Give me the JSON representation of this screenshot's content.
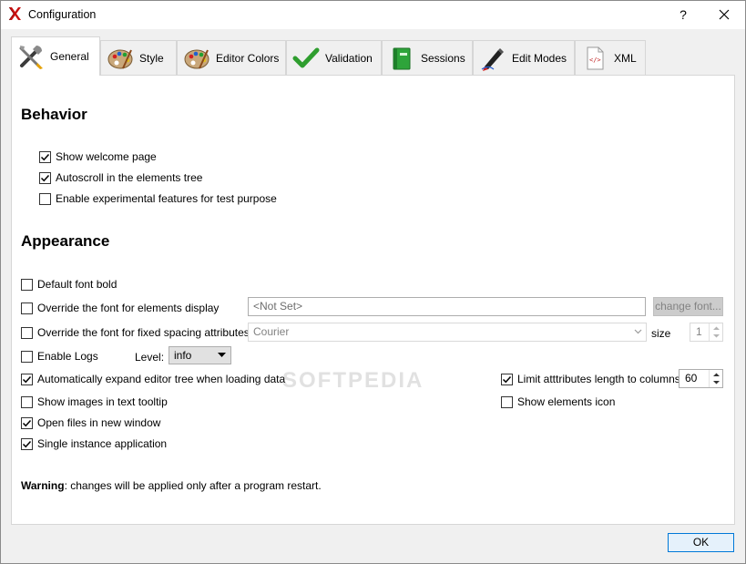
{
  "window": {
    "title": "Configuration",
    "help_label": "?",
    "close_icon": "close-icon"
  },
  "tabs": [
    {
      "label": "General",
      "icon": "tools-icon",
      "active": true
    },
    {
      "label": "Style",
      "icon": "palette-icon",
      "active": false
    },
    {
      "label": "Editor Colors",
      "icon": "palette-icon",
      "active": false
    },
    {
      "label": "Validation",
      "icon": "checkmark-icon",
      "active": false
    },
    {
      "label": "Sessions",
      "icon": "green-book-icon",
      "active": false
    },
    {
      "label": "Edit Modes",
      "icon": "pen-icon",
      "active": false
    },
    {
      "label": "XML",
      "icon": "xml-file-icon",
      "active": false
    }
  ],
  "behavior": {
    "title": "Behavior",
    "options": [
      {
        "label": "Show welcome page",
        "checked": true
      },
      {
        "label": "Autoscroll in the elements tree",
        "checked": true
      },
      {
        "label": "Enable experimental features for test purpose",
        "checked": false
      }
    ]
  },
  "appearance": {
    "title": "Appearance",
    "default_font_bold": {
      "label": "Default font bold",
      "checked": false
    },
    "override_elements_font": {
      "label": "Override the font for elements display",
      "checked": false,
      "value": "<Not Set>",
      "button": "change font..."
    },
    "override_fixed_font": {
      "label": "Override the font for fixed spacing attributes",
      "checked": false,
      "value": "Courier",
      "size_label": "size",
      "size_value": "1"
    },
    "enable_logs": {
      "label": "Enable Logs",
      "checked": false,
      "level_label": "Level:",
      "level_value": "info"
    },
    "auto_expand": {
      "label": "Automatically expand editor tree when loading data",
      "checked": true
    },
    "limit_attributes": {
      "label": "Limit atttributes length to columns:",
      "checked": true,
      "value": "60"
    },
    "show_images": {
      "label": "Show images in text tooltip",
      "checked": false
    },
    "show_elements_icon": {
      "label": "Show elements icon",
      "checked": false
    },
    "open_new_window": {
      "label": "Open files in new window",
      "checked": true
    },
    "single_instance": {
      "label": "Single instance application",
      "checked": true
    }
  },
  "warning": {
    "bold": "Warning",
    "text": ": changes will be applied only after a program restart."
  },
  "footer": {
    "ok_label": "OK"
  },
  "watermark": "SOFTPEDIA"
}
